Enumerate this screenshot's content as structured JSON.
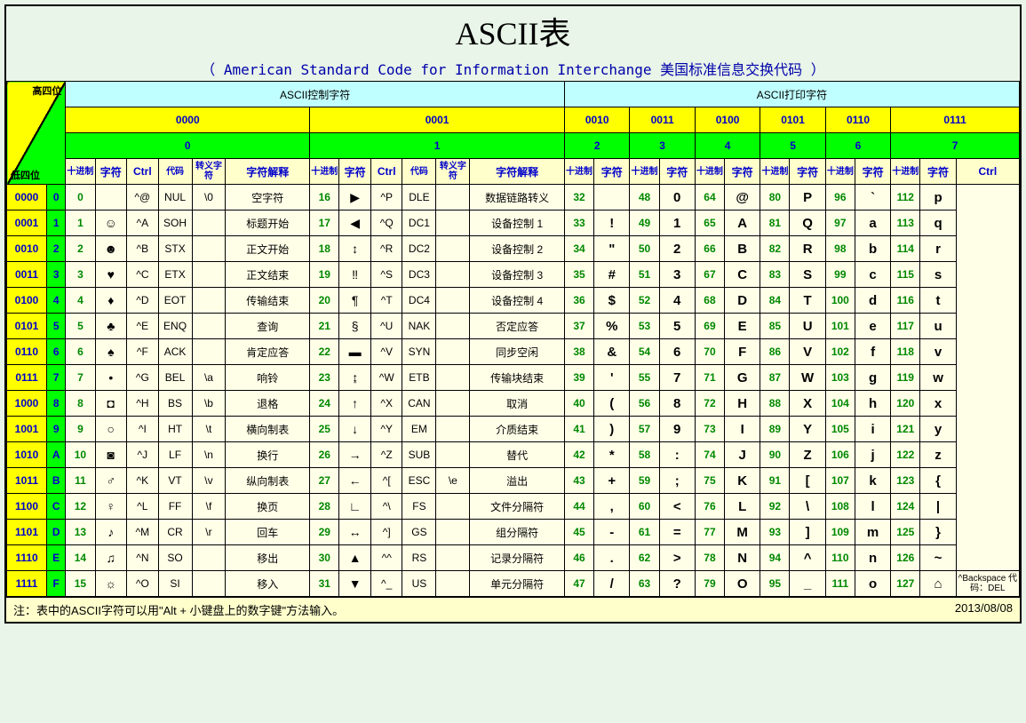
{
  "title": "ASCII表",
  "subtitle": "（ American Standard Code for Information Interchange  美国标准信息交换代码 ）",
  "hdr": {
    "high": "高四位",
    "low": "低四位",
    "ctrl_group": "ASCII控制字符",
    "print_group": "ASCII打印字符",
    "bin": [
      "0000",
      "0001",
      "0010",
      "0011",
      "0100",
      "0101",
      "0110",
      "0111"
    ],
    "hex": [
      "0",
      "1",
      "2",
      "3",
      "4",
      "5",
      "6",
      "7"
    ],
    "dec": "十进制",
    "char": "字符",
    "ctrl": "Ctrl",
    "code": "代码",
    "esc": "转义字符",
    "desc": "字符解释"
  },
  "rows": [
    {
      "bin": "0000",
      "hex": "0",
      "c0": {
        "d": "0",
        "ch": "",
        "ct": "^@",
        "cd": "NUL",
        "es": "\\0",
        "ds": "空字符"
      },
      "c1": {
        "d": "16",
        "ch": "▶",
        "ct": "^P",
        "cd": "DLE",
        "es": "",
        "ds": "数据链路转义"
      },
      "p": [
        [
          "32",
          ""
        ],
        [
          "48",
          "0"
        ],
        [
          "64",
          "@"
        ],
        [
          "80",
          "P"
        ],
        [
          "96",
          "`"
        ],
        [
          "112",
          "p"
        ]
      ]
    },
    {
      "bin": "0001",
      "hex": "1",
      "c0": {
        "d": "1",
        "ch": "☺",
        "ct": "^A",
        "cd": "SOH",
        "es": "",
        "ds": "标题开始"
      },
      "c1": {
        "d": "17",
        "ch": "◀",
        "ct": "^Q",
        "cd": "DC1",
        "es": "",
        "ds": "设备控制 1"
      },
      "p": [
        [
          "33",
          "!"
        ],
        [
          "49",
          "1"
        ],
        [
          "65",
          "A"
        ],
        [
          "81",
          "Q"
        ],
        [
          "97",
          "a"
        ],
        [
          "113",
          "q"
        ]
      ]
    },
    {
      "bin": "0010",
      "hex": "2",
      "c0": {
        "d": "2",
        "ch": "☻",
        "ct": "^B",
        "cd": "STX",
        "es": "",
        "ds": "正文开始"
      },
      "c1": {
        "d": "18",
        "ch": "↕",
        "ct": "^R",
        "cd": "DC2",
        "es": "",
        "ds": "设备控制 2"
      },
      "p": [
        [
          "34",
          "\""
        ],
        [
          "50",
          "2"
        ],
        [
          "66",
          "B"
        ],
        [
          "82",
          "R"
        ],
        [
          "98",
          "b"
        ],
        [
          "114",
          "r"
        ]
      ]
    },
    {
      "bin": "0011",
      "hex": "3",
      "c0": {
        "d": "3",
        "ch": "♥",
        "ct": "^C",
        "cd": "ETX",
        "es": "",
        "ds": "正文结束"
      },
      "c1": {
        "d": "19",
        "ch": "‼",
        "ct": "^S",
        "cd": "DC3",
        "es": "",
        "ds": "设备控制 3"
      },
      "p": [
        [
          "35",
          "#"
        ],
        [
          "51",
          "3"
        ],
        [
          "67",
          "C"
        ],
        [
          "83",
          "S"
        ],
        [
          "99",
          "c"
        ],
        [
          "115",
          "s"
        ]
      ]
    },
    {
      "bin": "0100",
      "hex": "4",
      "c0": {
        "d": "4",
        "ch": "♦",
        "ct": "^D",
        "cd": "EOT",
        "es": "",
        "ds": "传输结束"
      },
      "c1": {
        "d": "20",
        "ch": "¶",
        "ct": "^T",
        "cd": "DC4",
        "es": "",
        "ds": "设备控制 4"
      },
      "p": [
        [
          "36",
          "$"
        ],
        [
          "52",
          "4"
        ],
        [
          "68",
          "D"
        ],
        [
          "84",
          "T"
        ],
        [
          "100",
          "d"
        ],
        [
          "116",
          "t"
        ]
      ]
    },
    {
      "bin": "0101",
      "hex": "5",
      "c0": {
        "d": "5",
        "ch": "♣",
        "ct": "^E",
        "cd": "ENQ",
        "es": "",
        "ds": "查询"
      },
      "c1": {
        "d": "21",
        "ch": "§",
        "ct": "^U",
        "cd": "NAK",
        "es": "",
        "ds": "否定应答"
      },
      "p": [
        [
          "37",
          "%"
        ],
        [
          "53",
          "5"
        ],
        [
          "69",
          "E"
        ],
        [
          "85",
          "U"
        ],
        [
          "101",
          "e"
        ],
        [
          "117",
          "u"
        ]
      ]
    },
    {
      "bin": "0110",
      "hex": "6",
      "c0": {
        "d": "6",
        "ch": "♠",
        "ct": "^F",
        "cd": "ACK",
        "es": "",
        "ds": "肯定应答"
      },
      "c1": {
        "d": "22",
        "ch": "▬",
        "ct": "^V",
        "cd": "SYN",
        "es": "",
        "ds": "同步空闲"
      },
      "p": [
        [
          "38",
          "&"
        ],
        [
          "54",
          "6"
        ],
        [
          "70",
          "F"
        ],
        [
          "86",
          "V"
        ],
        [
          "102",
          "f"
        ],
        [
          "118",
          "v"
        ]
      ]
    },
    {
      "bin": "0111",
      "hex": "7",
      "c0": {
        "d": "7",
        "ch": "•",
        "ct": "^G",
        "cd": "BEL",
        "es": "\\a",
        "ds": "响铃"
      },
      "c1": {
        "d": "23",
        "ch": "↨",
        "ct": "^W",
        "cd": "ETB",
        "es": "",
        "ds": "传输块结束"
      },
      "p": [
        [
          "39",
          "'"
        ],
        [
          "55",
          "7"
        ],
        [
          "71",
          "G"
        ],
        [
          "87",
          "W"
        ],
        [
          "103",
          "g"
        ],
        [
          "119",
          "w"
        ]
      ]
    },
    {
      "bin": "1000",
      "hex": "8",
      "c0": {
        "d": "8",
        "ch": "◘",
        "ct": "^H",
        "cd": "BS",
        "es": "\\b",
        "ds": "退格"
      },
      "c1": {
        "d": "24",
        "ch": "↑",
        "ct": "^X",
        "cd": "CAN",
        "es": "",
        "ds": "取消"
      },
      "p": [
        [
          "40",
          "("
        ],
        [
          "56",
          "8"
        ],
        [
          "72",
          "H"
        ],
        [
          "88",
          "X"
        ],
        [
          "104",
          "h"
        ],
        [
          "120",
          "x"
        ]
      ]
    },
    {
      "bin": "1001",
      "hex": "9",
      "c0": {
        "d": "9",
        "ch": "○",
        "ct": "^I",
        "cd": "HT",
        "es": "\\t",
        "ds": "横向制表"
      },
      "c1": {
        "d": "25",
        "ch": "↓",
        "ct": "^Y",
        "cd": "EM",
        "es": "",
        "ds": "介质结束"
      },
      "p": [
        [
          "41",
          ")"
        ],
        [
          "57",
          "9"
        ],
        [
          "73",
          "I"
        ],
        [
          "89",
          "Y"
        ],
        [
          "105",
          "i"
        ],
        [
          "121",
          "y"
        ]
      ]
    },
    {
      "bin": "1010",
      "hex": "A",
      "c0": {
        "d": "10",
        "ch": "◙",
        "ct": "^J",
        "cd": "LF",
        "es": "\\n",
        "ds": "换行"
      },
      "c1": {
        "d": "26",
        "ch": "→",
        "ct": "^Z",
        "cd": "SUB",
        "es": "",
        "ds": "替代"
      },
      "p": [
        [
          "42",
          "*"
        ],
        [
          "58",
          ":"
        ],
        [
          "74",
          "J"
        ],
        [
          "90",
          "Z"
        ],
        [
          "106",
          "j"
        ],
        [
          "122",
          "z"
        ]
      ]
    },
    {
      "bin": "1011",
      "hex": "B",
      "c0": {
        "d": "11",
        "ch": "♂",
        "ct": "^K",
        "cd": "VT",
        "es": "\\v",
        "ds": "纵向制表"
      },
      "c1": {
        "d": "27",
        "ch": "←",
        "ct": "^[",
        "cd": "ESC",
        "es": "\\e",
        "ds": "溢出"
      },
      "p": [
        [
          "43",
          "+"
        ],
        [
          "59",
          ";"
        ],
        [
          "75",
          "K"
        ],
        [
          "91",
          "["
        ],
        [
          "107",
          "k"
        ],
        [
          "123",
          "{"
        ]
      ]
    },
    {
      "bin": "1100",
      "hex": "C",
      "c0": {
        "d": "12",
        "ch": "♀",
        "ct": "^L",
        "cd": "FF",
        "es": "\\f",
        "ds": "换页"
      },
      "c1": {
        "d": "28",
        "ch": "∟",
        "ct": "^\\",
        "cd": "FS",
        "es": "",
        "ds": "文件分隔符"
      },
      "p": [
        [
          "44",
          ","
        ],
        [
          "60",
          "<"
        ],
        [
          "76",
          "L"
        ],
        [
          "92",
          "\\"
        ],
        [
          "108",
          "l"
        ],
        [
          "124",
          "|"
        ]
      ]
    },
    {
      "bin": "1101",
      "hex": "D",
      "c0": {
        "d": "13",
        "ch": "♪",
        "ct": "^M",
        "cd": "CR",
        "es": "\\r",
        "ds": "回车"
      },
      "c1": {
        "d": "29",
        "ch": "↔",
        "ct": "^]",
        "cd": "GS",
        "es": "",
        "ds": "组分隔符"
      },
      "p": [
        [
          "45",
          "-"
        ],
        [
          "61",
          "="
        ],
        [
          "77",
          "M"
        ],
        [
          "93",
          "]"
        ],
        [
          "109",
          "m"
        ],
        [
          "125",
          "}"
        ]
      ]
    },
    {
      "bin": "1110",
      "hex": "E",
      "c0": {
        "d": "14",
        "ch": "♫",
        "ct": "^N",
        "cd": "SO",
        "es": "",
        "ds": "移出"
      },
      "c1": {
        "d": "30",
        "ch": "▲",
        "ct": "^^",
        "cd": "RS",
        "es": "",
        "ds": "记录分隔符"
      },
      "p": [
        [
          "46",
          "."
        ],
        [
          "62",
          ">"
        ],
        [
          "78",
          "N"
        ],
        [
          "94",
          "^"
        ],
        [
          "110",
          "n"
        ],
        [
          "126",
          "~"
        ]
      ]
    },
    {
      "bin": "1111",
      "hex": "F",
      "c0": {
        "d": "15",
        "ch": "☼",
        "ct": "^O",
        "cd": "SI",
        "es": "",
        "ds": "移入"
      },
      "c1": {
        "d": "31",
        "ch": "▼",
        "ct": "^_",
        "cd": "US",
        "es": "",
        "ds": "单元分隔符"
      },
      "p": [
        [
          "47",
          "/"
        ],
        [
          "63",
          "?"
        ],
        [
          "79",
          "O"
        ],
        [
          "95",
          "_"
        ],
        [
          "111",
          "o"
        ],
        [
          "127",
          "⌂"
        ]
      ]
    }
  ],
  "del_note": "^Backspace 代码：DEL",
  "footer_note": "注：表中的ASCII字符可以用\"Alt + 小键盘上的数字键\"方法输入。",
  "footer_date": "2013/08/08"
}
